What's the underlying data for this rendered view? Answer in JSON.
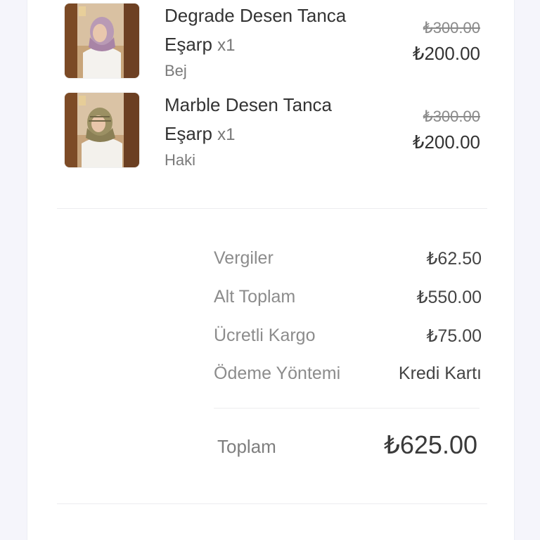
{
  "items": [
    {
      "title_line1": "Degrade Desen Tanca",
      "title_line2": "Eşarp",
      "qty": "x1",
      "variant": "Bej",
      "old_price": "₺300.00",
      "price": "₺200.00",
      "scarf_color": "#b99ab5"
    },
    {
      "title_line1": "Marble Desen Tanca",
      "title_line2": "Eşarp",
      "qty": "x1",
      "variant": "Haki",
      "old_price": "₺300.00",
      "price": "₺200.00",
      "scarf_color": "#9b9063"
    }
  ],
  "summary": {
    "taxes_label": "Vergiler",
    "taxes_value": "₺62.50",
    "subtotal_label": "Alt Toplam",
    "subtotal_value": "₺550.00",
    "shipping_label": "Ücretli Kargo",
    "shipping_value": "₺75.00",
    "payment_label": "Ödeme Yöntemi",
    "payment_value": "Kredi Kartı",
    "total_label": "Toplam",
    "total_value": "₺625.00"
  }
}
